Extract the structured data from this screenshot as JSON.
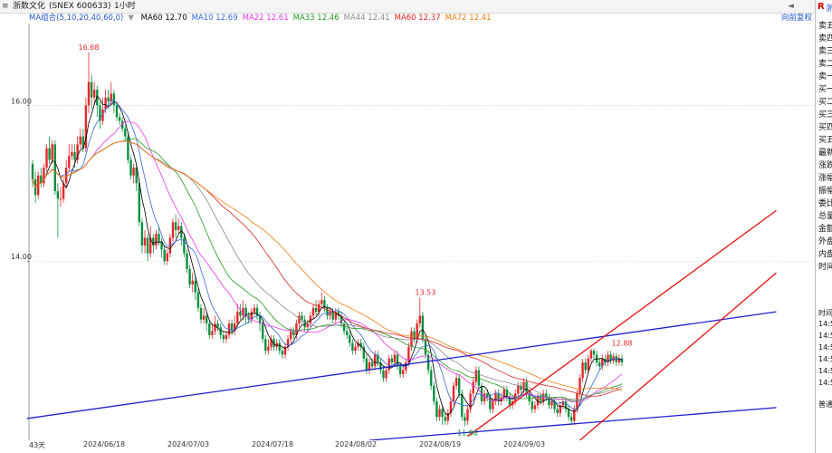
{
  "window": {
    "title_parts": [
      "≡",
      "浙数文化",
      "(SNEX 600633)",
      "1小时"
    ],
    "nav_button": "◄"
  },
  "ma_legend": {
    "group_label": "MA组合(5,10,20,40,60,0)",
    "items": [
      {
        "label": "MA60 12.70",
        "color": "#000000"
      },
      {
        "label": "MA10 12.69",
        "color": "#3366dd"
      },
      {
        "label": "MA22 12.61",
        "color": "#ee33ee"
      },
      {
        "label": "MA33 12.46",
        "color": "#229922"
      },
      {
        "label": "MA44 12.41",
        "color": "#888888"
      },
      {
        "label": "MA60 12.37",
        "color": "#dd2222"
      },
      {
        "label": "MA72 12.41",
        "color": "#f07a10"
      }
    ],
    "right_label": "向前复权"
  },
  "order_book": {
    "r_label": "R",
    "r_extra": "浙",
    "rows": [
      "卖五",
      "卖四",
      "卖三",
      "卖二",
      "卖一",
      "买一",
      "买二",
      "买三",
      "买四",
      "买五",
      "最新",
      "涨跌",
      "涨幅",
      "振幅",
      "委比",
      "总量",
      "金额",
      "外盘",
      "内盘",
      "时间"
    ]
  },
  "time_sales": {
    "header": "时间",
    "rows": [
      "14:5",
      "14:5",
      "14:5",
      "14:5",
      "14:5",
      "14:5"
    ],
    "footer": "普通"
  },
  "bottom": {
    "count_label": "43天",
    "date_labels": [
      "2024/06/18",
      "2024/07/03",
      "2024/07/18",
      "2024/08/02",
      "2024/08/19",
      "2024/09/03"
    ]
  },
  "chart_data": {
    "type": "candlestick",
    "title": "",
    "xlabel": "",
    "ylabel": "",
    "ylim": [
      11.7,
      17.05
    ],
    "y_ticks": [
      14.0,
      16.0
    ],
    "y_tick_labels": [
      "14.00",
      "16.00"
    ],
    "grid": "horizontal dotted",
    "up_color": "#e8262a",
    "down_color": "#0a8f3d",
    "annotations": [
      {
        "text": "16.68",
        "value": 16.68,
        "bar": 20
      },
      {
        "text": "13.53",
        "value": 13.53,
        "bar": 140
      },
      {
        "text": "11.88",
        "value": 11.88,
        "bar": 155
      },
      {
        "text": "12.88",
        "value": 12.88,
        "bar": 210
      }
    ],
    "candles": [
      [
        15.25,
        15.05,
        15.3,
        14.95
      ],
      [
        15.05,
        14.85,
        15.15,
        14.75
      ],
      [
        14.85,
        15.1,
        15.15,
        14.8
      ],
      [
        15.1,
        15.0,
        15.2,
        14.95
      ],
      [
        15.0,
        15.2,
        15.25,
        14.95
      ],
      [
        15.2,
        15.45,
        15.5,
        15.15
      ],
      [
        15.45,
        15.3,
        15.6,
        15.25
      ],
      [
        15.3,
        15.5,
        15.55,
        15.25
      ],
      [
        15.5,
        14.9,
        15.55,
        14.85
      ],
      [
        14.9,
        14.8,
        15.0,
        14.3
      ],
      [
        14.8,
        14.8,
        14.95,
        14.7
      ],
      [
        14.8,
        15.0,
        15.05,
        14.75
      ],
      [
        15.0,
        15.2,
        15.3,
        14.95
      ],
      [
        15.2,
        15.35,
        15.5,
        15.15
      ],
      [
        15.35,
        15.4,
        15.5,
        15.3
      ],
      [
        15.4,
        15.3,
        15.5,
        15.2
      ],
      [
        15.3,
        15.5,
        15.6,
        15.25
      ],
      [
        15.5,
        15.6,
        15.7,
        15.45
      ],
      [
        15.6,
        15.45,
        15.7,
        15.4
      ],
      [
        15.45,
        16.0,
        16.1,
        15.4
      ],
      [
        16.0,
        16.3,
        16.68,
        15.9
      ],
      [
        16.3,
        16.1,
        16.4,
        15.95
      ],
      [
        16.1,
        16.2,
        16.3,
        16.0
      ],
      [
        16.2,
        16.0,
        16.25,
        15.85
      ],
      [
        16.0,
        15.8,
        16.05,
        15.7
      ],
      [
        15.8,
        15.95,
        16.1,
        15.75
      ],
      [
        15.95,
        16.1,
        16.2,
        15.9
      ],
      [
        16.1,
        16.05,
        16.2,
        15.95
      ],
      [
        16.05,
        16.15,
        16.3,
        16.0
      ],
      [
        16.15,
        16.0,
        16.2,
        15.9
      ],
      [
        16.0,
        15.85,
        16.05,
        15.8
      ],
      [
        15.85,
        15.8,
        15.9,
        15.75
      ],
      [
        15.8,
        15.7,
        15.85,
        15.65
      ],
      [
        15.7,
        15.6,
        15.75,
        15.55
      ],
      [
        15.6,
        15.3,
        15.65,
        15.25
      ],
      [
        15.3,
        15.1,
        15.35,
        15.05
      ],
      [
        15.1,
        15.2,
        15.25,
        15.0
      ],
      [
        15.2,
        15.0,
        15.25,
        14.9
      ],
      [
        15.0,
        14.5,
        15.05,
        14.45
      ],
      [
        14.5,
        14.2,
        14.55,
        14.1
      ],
      [
        14.2,
        14.3,
        14.4,
        14.1
      ],
      [
        14.3,
        14.1,
        14.35,
        14.0
      ],
      [
        14.1,
        14.3,
        14.45,
        14.05
      ],
      [
        14.3,
        14.2,
        14.35,
        14.1
      ],
      [
        14.2,
        14.35,
        14.4,
        14.15
      ],
      [
        14.35,
        14.25,
        14.45,
        14.2
      ],
      [
        14.25,
        14.15,
        14.3,
        14.05
      ],
      [
        14.15,
        14.0,
        14.2,
        13.95
      ],
      [
        14.0,
        14.1,
        14.15,
        13.95
      ],
      [
        14.1,
        14.3,
        14.35,
        14.05
      ],
      [
        14.3,
        14.5,
        14.55,
        14.25
      ],
      [
        14.5,
        14.4,
        14.6,
        14.3
      ],
      [
        14.4,
        14.45,
        14.55,
        14.35
      ],
      [
        14.45,
        14.3,
        14.5,
        14.2
      ],
      [
        14.3,
        14.1,
        14.35,
        14.05
      ],
      [
        14.1,
        13.9,
        14.15,
        13.85
      ],
      [
        13.9,
        13.7,
        13.95,
        13.65
      ],
      [
        13.7,
        13.75,
        13.85,
        13.6
      ],
      [
        13.75,
        13.6,
        13.8,
        13.5
      ],
      [
        13.6,
        13.4,
        13.65,
        13.35
      ],
      [
        13.4,
        13.25,
        13.45,
        13.2
      ],
      [
        13.25,
        13.3,
        13.4,
        13.2
      ],
      [
        13.3,
        13.2,
        13.35,
        13.1
      ],
      [
        13.2,
        13.05,
        13.25,
        13.0
      ],
      [
        13.05,
        13.1,
        13.2,
        13.0
      ],
      [
        13.1,
        13.2,
        13.3,
        13.05
      ],
      [
        13.2,
        13.15,
        13.25,
        13.1
      ],
      [
        13.15,
        13.05,
        13.2,
        13.0
      ],
      [
        13.05,
        13.0,
        13.1,
        12.95
      ],
      [
        13.0,
        13.05,
        13.1,
        12.95
      ],
      [
        13.05,
        13.2,
        13.25,
        13.0
      ],
      [
        13.2,
        13.1,
        13.25,
        13.05
      ],
      [
        13.1,
        13.2,
        13.3,
        13.05
      ],
      [
        13.2,
        13.35,
        13.45,
        13.15
      ],
      [
        13.35,
        13.3,
        13.45,
        13.25
      ],
      [
        13.3,
        13.4,
        13.5,
        13.25
      ],
      [
        13.4,
        13.3,
        13.45,
        13.2
      ],
      [
        13.3,
        13.25,
        13.35,
        13.2
      ],
      [
        13.25,
        13.35,
        13.4,
        13.2
      ],
      [
        13.35,
        13.4,
        13.45,
        13.3
      ],
      [
        13.4,
        13.3,
        13.45,
        13.25
      ],
      [
        13.3,
        13.2,
        13.35,
        13.1
      ],
      [
        13.2,
        13.0,
        13.25,
        12.95
      ],
      [
        13.0,
        12.85,
        13.05,
        12.8
      ],
      [
        12.85,
        12.9,
        13.0,
        12.8
      ],
      [
        12.9,
        13.0,
        13.05,
        12.85
      ],
      [
        13.0,
        12.9,
        13.05,
        12.85
      ],
      [
        12.9,
        12.95,
        13.0,
        12.85
      ],
      [
        12.95,
        12.85,
        13.0,
        12.8
      ],
      [
        12.85,
        12.8,
        12.9,
        12.75
      ],
      [
        12.8,
        12.9,
        12.95,
        12.75
      ],
      [
        12.9,
        13.0,
        13.05,
        12.85
      ],
      [
        13.0,
        13.1,
        13.15,
        12.95
      ],
      [
        13.1,
        13.05,
        13.15,
        13.0
      ],
      [
        13.05,
        13.2,
        13.25,
        13.0
      ],
      [
        13.2,
        13.3,
        13.35,
        13.15
      ],
      [
        13.3,
        13.25,
        13.35,
        13.2
      ],
      [
        13.25,
        13.15,
        13.3,
        13.1
      ],
      [
        13.15,
        13.2,
        13.25,
        13.1
      ],
      [
        13.2,
        13.3,
        13.35,
        13.15
      ],
      [
        13.3,
        13.4,
        13.45,
        13.25
      ],
      [
        13.4,
        13.35,
        13.5,
        13.3
      ],
      [
        13.35,
        13.45,
        13.5,
        13.3
      ],
      [
        13.45,
        13.5,
        13.6,
        13.4
      ],
      [
        13.5,
        13.4,
        13.55,
        13.35
      ],
      [
        13.4,
        13.3,
        13.45,
        13.25
      ],
      [
        13.3,
        13.35,
        13.4,
        13.25
      ],
      [
        13.35,
        13.25,
        13.4,
        13.2
      ],
      [
        13.25,
        13.35,
        13.4,
        13.2
      ],
      [
        13.35,
        13.3,
        13.4,
        13.25
      ],
      [
        13.3,
        13.2,
        13.35,
        13.15
      ],
      [
        13.2,
        13.1,
        13.25,
        13.05
      ],
      [
        13.1,
        13.05,
        13.15,
        13.0
      ],
      [
        13.05,
        12.95,
        13.1,
        12.9
      ],
      [
        12.95,
        12.85,
        13.0,
        12.8
      ],
      [
        12.85,
        12.9,
        12.95,
        12.8
      ],
      [
        12.9,
        12.95,
        13.0,
        12.85
      ],
      [
        12.95,
        12.9,
        13.0,
        12.85
      ],
      [
        12.9,
        12.75,
        12.95,
        12.7
      ],
      [
        12.75,
        12.6,
        12.8,
        12.55
      ],
      [
        12.6,
        12.7,
        12.75,
        12.55
      ],
      [
        12.7,
        12.65,
        12.75,
        12.6
      ],
      [
        12.65,
        12.8,
        12.85,
        12.6
      ],
      [
        12.8,
        12.7,
        12.85,
        12.65
      ],
      [
        12.7,
        12.6,
        12.75,
        12.55
      ],
      [
        12.6,
        12.5,
        12.65,
        12.45
      ],
      [
        12.5,
        12.6,
        12.65,
        12.45
      ],
      [
        12.6,
        12.75,
        12.8,
        12.55
      ],
      [
        12.75,
        12.7,
        12.8,
        12.65
      ],
      [
        12.7,
        12.8,
        12.85,
        12.65
      ],
      [
        12.8,
        12.65,
        12.85,
        12.6
      ],
      [
        12.65,
        12.55,
        12.7,
        12.5
      ],
      [
        12.55,
        12.6,
        12.65,
        12.5
      ],
      [
        12.6,
        12.7,
        12.75,
        12.55
      ],
      [
        12.7,
        12.9,
        12.95,
        12.65
      ],
      [
        12.9,
        13.1,
        13.15,
        12.85
      ],
      [
        13.1,
        13.0,
        13.15,
        12.95
      ],
      [
        13.0,
        13.2,
        13.25,
        12.95
      ],
      [
        13.2,
        13.3,
        13.53,
        13.15
      ],
      [
        13.3,
        13.0,
        13.35,
        12.95
      ],
      [
        13.0,
        12.8,
        13.05,
        12.75
      ],
      [
        12.8,
        12.6,
        12.85,
        12.55
      ],
      [
        12.6,
        12.4,
        12.65,
        12.35
      ],
      [
        12.4,
        12.2,
        12.45,
        12.15
      ],
      [
        12.2,
        12.0,
        12.25,
        11.95
      ],
      [
        12.0,
        12.1,
        12.15,
        11.95
      ],
      [
        12.1,
        12.0,
        12.15,
        11.9
      ],
      [
        12.0,
        11.95,
        12.05,
        11.9
      ],
      [
        11.95,
        12.05,
        12.1,
        11.9
      ],
      [
        12.05,
        12.2,
        12.25,
        12.0
      ],
      [
        12.2,
        12.4,
        12.45,
        12.15
      ],
      [
        12.4,
        12.5,
        12.55,
        12.35
      ],
      [
        12.5,
        12.3,
        12.55,
        12.25
      ],
      [
        12.3,
        12.0,
        12.35,
        11.95
      ],
      [
        12.0,
        11.95,
        12.05,
        11.88
      ],
      [
        11.95,
        12.1,
        12.15,
        11.9
      ],
      [
        12.1,
        12.3,
        12.35,
        12.05
      ],
      [
        12.3,
        12.45,
        12.5,
        12.25
      ],
      [
        12.45,
        12.6,
        12.65,
        12.4
      ],
      [
        12.6,
        12.4,
        12.65,
        12.35
      ],
      [
        12.4,
        12.2,
        12.45,
        12.15
      ],
      [
        12.2,
        12.3,
        12.35,
        12.15
      ],
      [
        12.3,
        12.25,
        12.35,
        12.2
      ],
      [
        12.25,
        12.1,
        12.3,
        12.05
      ],
      [
        12.1,
        12.2,
        12.25,
        12.05
      ],
      [
        12.2,
        12.3,
        12.35,
        12.15
      ],
      [
        12.3,
        12.2,
        12.35,
        12.15
      ],
      [
        12.2,
        12.25,
        12.3,
        12.15
      ],
      [
        12.25,
        12.35,
        12.4,
        12.2
      ],
      [
        12.35,
        12.25,
        12.4,
        12.2
      ],
      [
        12.25,
        12.15,
        12.3,
        12.1
      ],
      [
        12.15,
        12.2,
        12.25,
        12.1
      ],
      [
        12.2,
        12.3,
        12.35,
        12.15
      ],
      [
        12.3,
        12.4,
        12.45,
        12.25
      ],
      [
        12.4,
        12.35,
        12.45,
        12.3
      ],
      [
        12.35,
        12.45,
        12.5,
        12.3
      ],
      [
        12.45,
        12.3,
        12.5,
        12.25
      ],
      [
        12.3,
        12.2,
        12.35,
        12.15
      ],
      [
        12.2,
        12.1,
        12.25,
        12.05
      ],
      [
        12.1,
        12.15,
        12.2,
        12.05
      ],
      [
        12.15,
        12.25,
        12.3,
        12.1
      ],
      [
        12.25,
        12.2,
        12.3,
        12.15
      ],
      [
        12.2,
        12.3,
        12.35,
        12.15
      ],
      [
        12.3,
        12.25,
        12.35,
        12.2
      ],
      [
        12.25,
        12.15,
        12.3,
        12.1
      ],
      [
        12.15,
        12.2,
        12.25,
        12.1
      ],
      [
        12.2,
        12.1,
        12.25,
        12.05
      ],
      [
        12.1,
        12.05,
        12.15,
        12.0
      ],
      [
        12.05,
        12.15,
        12.2,
        12.0
      ],
      [
        12.15,
        12.2,
        12.25,
        12.1
      ],
      [
        12.2,
        12.1,
        12.25,
        12.05
      ],
      [
        12.1,
        12.0,
        12.15,
        11.95
      ],
      [
        12.0,
        11.95,
        12.05,
        11.9
      ],
      [
        11.95,
        12.1,
        12.15,
        11.9
      ],
      [
        12.1,
        12.3,
        12.35,
        12.05
      ],
      [
        12.3,
        12.5,
        12.55,
        12.25
      ],
      [
        12.5,
        12.7,
        12.75,
        12.45
      ],
      [
        12.7,
        12.6,
        12.75,
        12.55
      ],
      [
        12.6,
        12.75,
        12.8,
        12.55
      ],
      [
        12.75,
        12.85,
        12.88,
        12.7
      ],
      [
        12.85,
        12.8,
        12.88,
        12.75
      ],
      [
        12.8,
        12.7,
        12.85,
        12.65
      ],
      [
        12.7,
        12.65,
        12.75,
        12.6
      ],
      [
        12.65,
        12.75,
        12.8,
        12.6
      ],
      [
        12.75,
        12.7,
        12.8,
        12.65
      ],
      [
        12.7,
        12.8,
        12.85,
        12.65
      ],
      [
        12.8,
        12.72,
        12.85,
        12.68
      ],
      [
        12.72,
        12.78,
        12.82,
        12.68
      ],
      [
        12.78,
        12.7,
        12.82,
        12.65
      ],
      [
        12.7,
        12.75,
        12.8,
        12.66
      ],
      [
        12.75,
        12.7,
        12.8,
        12.65
      ]
    ],
    "moving_averages": [
      {
        "name": "MA5",
        "period": 5,
        "color": "#000000"
      },
      {
        "name": "MA10",
        "period": 10,
        "color": "#3366dd"
      },
      {
        "name": "MA22",
        "period": 22,
        "color": "#ee33ee"
      },
      {
        "name": "MA33",
        "period": 33,
        "color": "#229922"
      },
      {
        "name": "MA44",
        "period": 44,
        "color": "#888888"
      },
      {
        "name": "MA60",
        "period": 60,
        "color": "#dd2222"
      },
      {
        "name": "MA72",
        "period": 72,
        "color": "#f07a10"
      }
    ],
    "trendlines": [
      {
        "color": "#1f1fd0",
        "from": {
          "bar": -2,
          "value": 11.98
        },
        "to": {
          "bar": 265,
          "value": 13.35
        }
      },
      {
        "color": "#1f1fd0",
        "from": {
          "bar": 120,
          "value": 11.7
        },
        "to": {
          "bar": 265,
          "value": 12.12
        }
      },
      {
        "color": "#e81010",
        "from": {
          "bar": 155,
          "value": 11.75
        },
        "to": {
          "bar": 265,
          "value": 14.65
        }
      },
      {
        "color": "#e81010",
        "from": {
          "bar": 195,
          "value": 11.7
        },
        "to": {
          "bar": 265,
          "value": 13.85
        }
      }
    ]
  }
}
